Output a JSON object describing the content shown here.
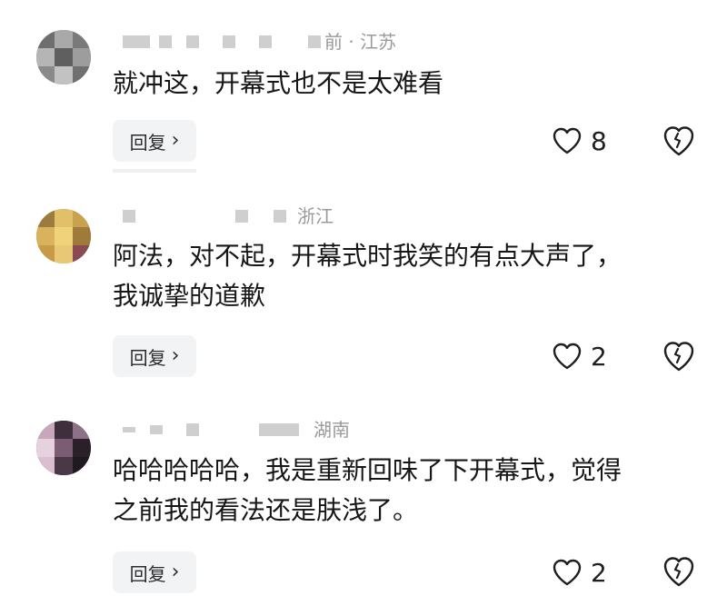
{
  "comments": [
    {
      "region": "前 · 江苏",
      "text_lines": [
        "就冲这，开幕式也不是太难看"
      ],
      "reply_label": "回复",
      "like_count": "8"
    },
    {
      "region": "浙江",
      "text_lines": [
        "阿法，对不起，开幕式时我笑的有点大声了，",
        "我诚挚的道歉"
      ],
      "reply_label": "回复",
      "like_count": "2"
    },
    {
      "region": "湖南",
      "text_lines": [
        "哈哈哈哈哈，我是重新回味了下开幕式，觉得",
        "之前我的看法还是肤浅了。"
      ],
      "reply_label": "回复",
      "like_count": "2"
    }
  ],
  "icons": {
    "like": "heart-outline-icon",
    "dislike": "broken-heart-icon",
    "reply_chevron": "chevron-right-icon"
  },
  "colors": {
    "text": "#161616",
    "meta": "#9a9a9a",
    "reply_bg": "#f2f3f5"
  }
}
